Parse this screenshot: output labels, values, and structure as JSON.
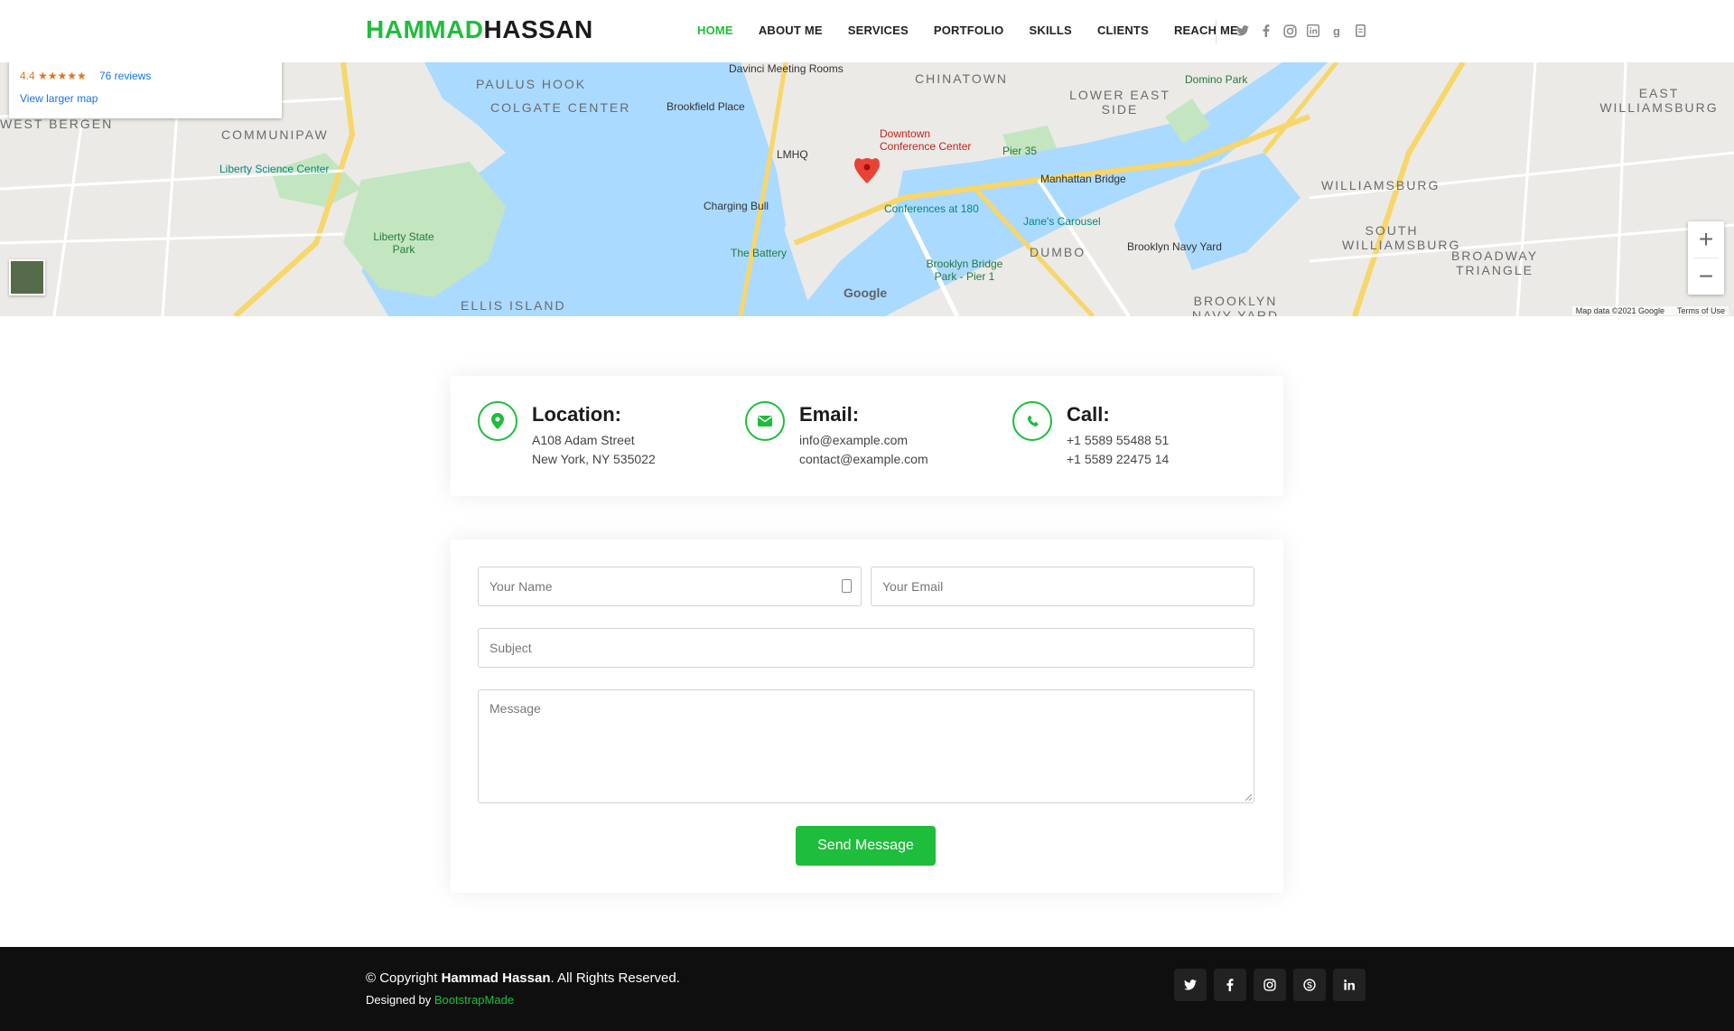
{
  "brand": {
    "first": "HAMMAD",
    "second": "HASSAN",
    "accent_color": "#1ebd3c"
  },
  "nav": {
    "items": [
      {
        "label": "HOME",
        "active": true
      },
      {
        "label": "ABOUT ME"
      },
      {
        "label": "SERVICES"
      },
      {
        "label": "PORTFOLIO"
      },
      {
        "label": "SKILLS"
      },
      {
        "label": "CLIENTS"
      },
      {
        "label": "REACH ME"
      }
    ],
    "social_icons": [
      "twitter-icon",
      "facebook-icon",
      "instagram-icon",
      "linkedin-icon",
      "google-plus-icon",
      "document-icon"
    ]
  },
  "map": {
    "rating": "4.4 ★★★★★",
    "reviews": "76 reviews",
    "larger_link": "View larger map",
    "zoom_in": "+",
    "zoom_out": "−",
    "footer_data": "Map data ©2021 Google",
    "footer_terms": "Terms of Use",
    "labels": {
      "paulus_hook": "PAULUS HOOK",
      "colgate": "COLGATE CENTER",
      "chinatown": "CHINATOWN",
      "lower_east": "LOWER EAST SIDE",
      "east_williamsburg": "EAST WILLIAMSBURG",
      "west_bergen": "WEST BERGEN",
      "communipaw": "COMMUNIPAW",
      "liberty_science": "Liberty Science Center",
      "liberty_park": "Liberty State Park",
      "ellis": "ELLIS ISLAND",
      "davinci": "Davinci Meeting Rooms",
      "brookfield": "Brookfield Place",
      "lmhq": "LMHQ",
      "downtown": "Downtown Conference Center",
      "charging_bull": "Charging Bull",
      "conferences": "Conferences at 180",
      "battery": "The Battery",
      "pier35": "Pier 35",
      "manhattan_bridge": "Manhattan Bridge",
      "janes": "Jane's Carousel",
      "dumbo": "DUMBO",
      "bbp": "Brooklyn Bridge Park - Pier 1",
      "domino": "Domino Park",
      "williamsburg": "WILLIAMSBURG",
      "south_williamsburg": "SOUTH WILLIAMSBURG",
      "navy_yard": "Brooklyn Navy Yard",
      "broadway_triangle": "BROADWAY TRIANGLE",
      "bk_navy": "BROOKLYN NAVY YARD",
      "google": "Google"
    }
  },
  "contact_info": {
    "location": {
      "title": "Location:",
      "line1": "A108 Adam Street",
      "line2": "New York, NY 535022",
      "icon": "map-pin-icon"
    },
    "email": {
      "title": "Email:",
      "line1": "info@example.com",
      "line2": "contact@example.com",
      "icon": "envelope-icon"
    },
    "call": {
      "title": "Call:",
      "line1": "+1 5589 55488 51",
      "line2": "+1 5589 22475 14",
      "icon": "phone-icon"
    }
  },
  "form": {
    "name_placeholder": "Your Name",
    "email_placeholder": "Your Email",
    "subject_placeholder": "Subject",
    "message_placeholder": "Message",
    "submit_label": "Send Message"
  },
  "footer": {
    "copyright_prefix": "© Copyright ",
    "copyright_name": "Hammad Hassan",
    "copyright_suffix": ". All Rights Reserved.",
    "designed_prefix": "Designed by ",
    "designed_by": "BootstrapMade",
    "social_icons": [
      "twitter-icon",
      "facebook-icon",
      "instagram-icon",
      "skype-icon",
      "linkedin-icon"
    ]
  }
}
